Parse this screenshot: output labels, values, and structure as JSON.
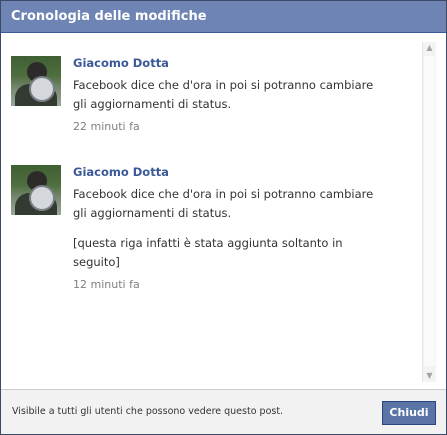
{
  "dialog": {
    "title": "Cronologia delle modifiche",
    "footer_note": "Visibile a tutti gli utenti che possono vedere questo post.",
    "close_label": "Chiudi"
  },
  "entries": [
    {
      "author": "Giacomo Dotta",
      "lines": [
        "Facebook dice che d'ora in poi si potranno cambiare",
        "gli aggiornamenti di status."
      ],
      "extra_lines": [],
      "time": "22 minuti fa"
    },
    {
      "author": "Giacomo Dotta",
      "lines": [
        "Facebook dice che d'ora in poi si potranno cambiare",
        "gli aggiornamenti di status."
      ],
      "extra_lines": [
        "[questa riga infatti è stata aggiunta soltanto in",
        "seguito]"
      ],
      "time": "12 minuti fa"
    }
  ],
  "scrollbar": {
    "up_icon": "▲",
    "down_icon": "▼"
  },
  "colors": {
    "title_bar": "#6d84b4",
    "author_link": "#3b5998",
    "close_button": "#5b74a8"
  }
}
